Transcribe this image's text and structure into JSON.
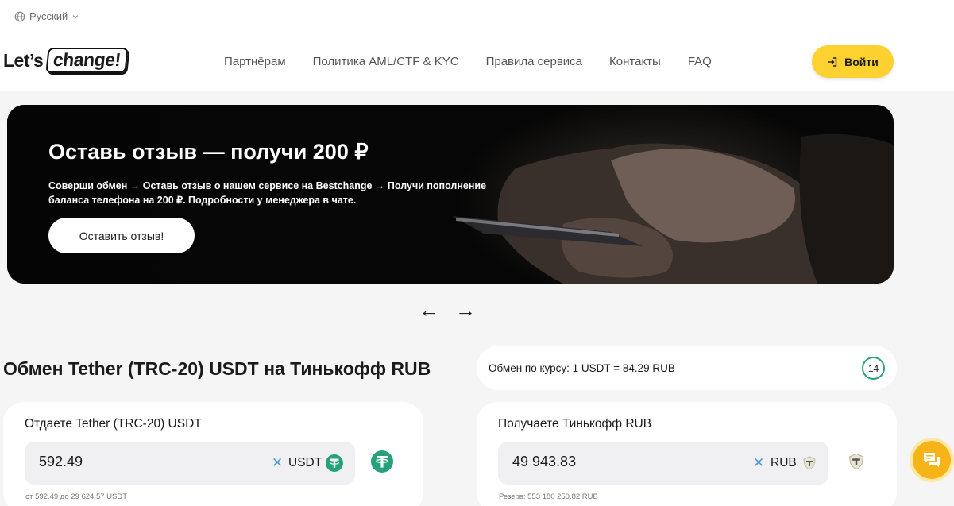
{
  "language": {
    "label": "Русский"
  },
  "logo": {
    "part1": "Let’s",
    "part2": "change!"
  },
  "nav": [
    "Партнёрам",
    "Политика AML/CTF & KYC",
    "Правила сервиса",
    "Контакты",
    "FAQ"
  ],
  "login": {
    "label": "Войти"
  },
  "banner": {
    "title": "Оставь отзыв — получи 200 ₽",
    "text": "Соверши обмен → Оставь отзыв о нашем сервисе на Bestchange → Получи пополнение баланса телефона на 200 ₽. Подробности у менеджера в чате.",
    "button": "Оставить отзыв!"
  },
  "carousel": {
    "prev": "←",
    "next": "→"
  },
  "exchange": {
    "title": "Обмен Tether (TRC-20) USDT на Тинькофф RUB",
    "rate": "Обмен по курсу: 1 USDT = 84.29 RUB",
    "timer": "14",
    "give": {
      "label": "Отдаете Tether (TRC-20) USDT",
      "value": "592.49",
      "currency": "USDT",
      "min_prefix": "от",
      "min": "592.49",
      "max_prefix": "до",
      "max": "29 624.57 USDT"
    },
    "get": {
      "label": "Получаете Тинькофф RUB",
      "value": "49 943.83",
      "currency": "RUB",
      "reserve": "Резерв: 553 180 250.82 RUB"
    }
  },
  "colors": {
    "accent": "#fdd230",
    "tether": "#26a17b",
    "chat": "#f6b418"
  }
}
